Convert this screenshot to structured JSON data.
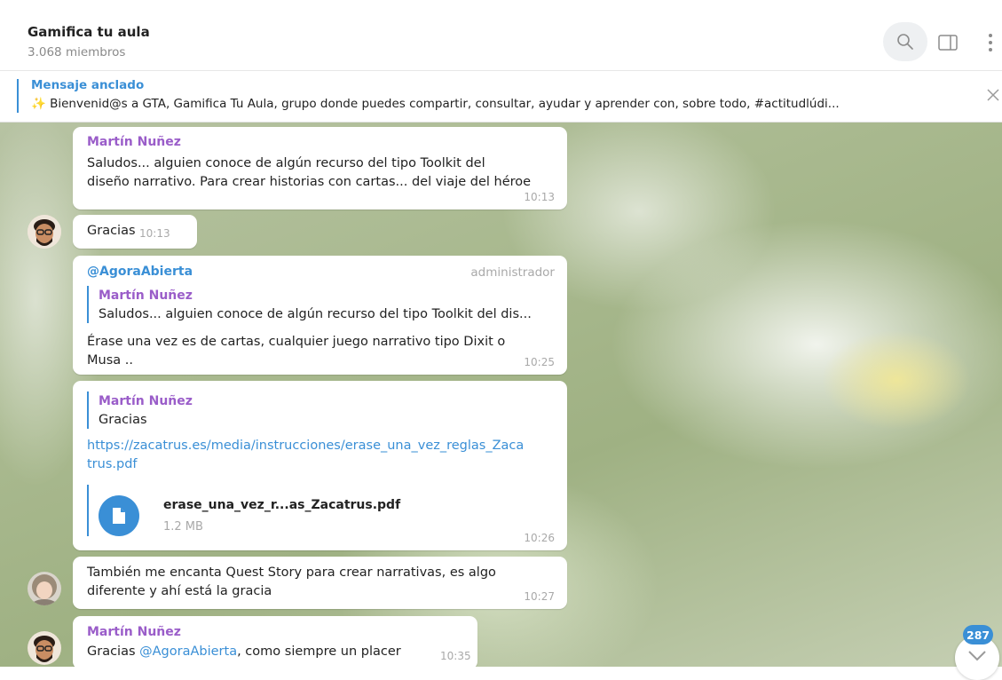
{
  "header": {
    "title": "Gamifica tu aula",
    "members": "3.068 miembros"
  },
  "pinned": {
    "label": "Mensaje anclado",
    "text": "✨ Bienvenid@s a GTA, Gamifica Tu Aula, grupo donde puedes compartir, consultar, ayudar y aprender con, sobre todo, #actitudlúdi..."
  },
  "messages": [
    {
      "sender": "Martín Nuñez",
      "lines": [
        "Saludos... alguien conoce de algún recurso del tipo Toolkit del",
        "diseño narrativo. Para crear historias con cartas... del viaje del héroe"
      ],
      "time": "10:13"
    },
    {
      "text": "Gracias",
      "time": "10:13"
    },
    {
      "sender": "@AgoraAbierta",
      "role": "administrador",
      "reply_sender": "Martín Nuñez",
      "reply_text": "Saludos... alguien conoce de algún recurso del tipo Toolkit del dis...",
      "lines": [
        "Érase una vez es de cartas, cualquier juego narrativo tipo Dixit o",
        "Musa .."
      ],
      "time": "10:25"
    },
    {
      "reply_sender": "Martín Nuñez",
      "reply_text": "Gracias",
      "link_lines": [
        "https://zacatrus.es/media/instrucciones/erase_una_vez_reglas_Zaca",
        "trus.pdf"
      ],
      "file_name": "erase_una_vez_r...as_Zacatrus.pdf",
      "file_size": "1.2 MB",
      "time": "10:26"
    },
    {
      "lines": [
        "También me encanta Quest Story para crear narrativas, es algo",
        "diferente y ahí está la gracia"
      ],
      "time": "10:27"
    },
    {
      "sender": "Martín Nuñez",
      "text_before": "Gracias ",
      "mention": "@AgoraAbierta",
      "text_after": ", como siempre un placer",
      "time": "10:35"
    }
  ],
  "unread_count": "287",
  "icons": {
    "search": "search-icon",
    "panel": "side-panel-icon",
    "more": "more-vertical-icon",
    "close": "close-icon",
    "file": "file-icon",
    "scroll": "chevron-down-icon"
  },
  "colors": {
    "accent": "#3a8fd6",
    "sender": "#9a5dc9"
  }
}
